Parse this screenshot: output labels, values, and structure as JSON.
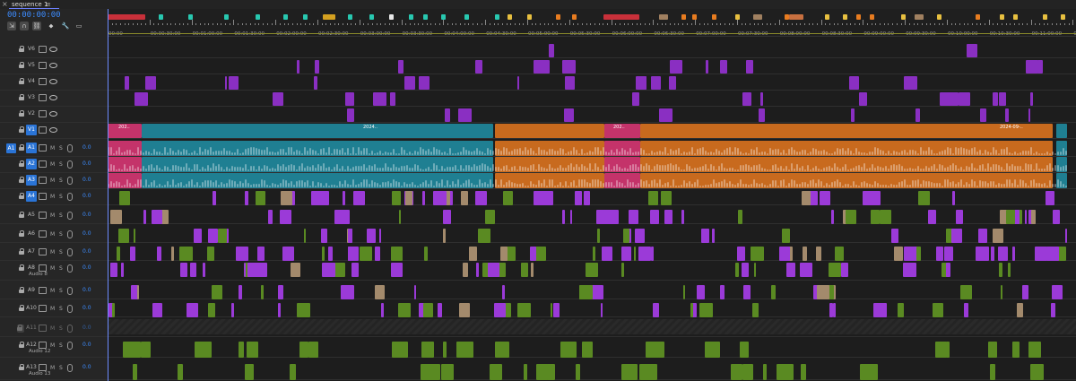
{
  "tab": {
    "name": "sequence 1",
    "close_glyph": "×",
    "menu_glyph": "≡"
  },
  "timecode": "00:00:00:00",
  "tools": [
    {
      "name": "insert-overwrite-icon",
      "glyph": "⇲"
    },
    {
      "name": "snap-icon",
      "glyph": "∩"
    },
    {
      "name": "linked-selection-icon",
      "glyph": "⛓"
    },
    {
      "name": "add-marker-icon",
      "glyph": "⬥"
    },
    {
      "name": "wrench-icon",
      "glyph": "🔧"
    },
    {
      "name": "captions-icon",
      "glyph": "▭"
    }
  ],
  "ruler": {
    "labels": [
      "00:00",
      "00:00:30:00",
      "00:01:00:00",
      "00:01:30:00",
      "00:02:00:00",
      "00:02:30:00",
      "00:03:00:00",
      "00:03:30:00",
      "00:04:00:00",
      "00:04:30:00",
      "00:05:00:00",
      "00:05:30:00",
      "00:06:00:00",
      "00:06:30:00",
      "00:07:00:00",
      "00:07:30:00",
      "00:08:00:00",
      "00:08:30:00",
      "00:09:00:00",
      "00:09:30:00",
      "00:10:00:00",
      "00:10:30:00",
      "00:11:00:00",
      "00:1"
    ]
  },
  "colors": {
    "accent": "#2a74d6",
    "timecode": "#3d8cff",
    "clip_pink": "#c4336a",
    "clip_teal": "#1f7f92",
    "clip_orange": "#c86a1e",
    "clip_purple": "#8a2fc2",
    "clip_violet": "#9b3ad8",
    "clip_green": "#5a8a22",
    "clip_tan": "#a38a6c"
  },
  "video_tracks": [
    {
      "name": "V6"
    },
    {
      "name": "V5"
    },
    {
      "name": "V4"
    },
    {
      "name": "V3"
    },
    {
      "name": "V2"
    },
    {
      "name": "V1",
      "active": true
    }
  ],
  "audio_tracks": [
    {
      "name": "A1",
      "src": "A1",
      "active": true,
      "m": "M",
      "s": "S",
      "vol": "0.0"
    },
    {
      "name": "A2",
      "active": true,
      "m": "M",
      "s": "S",
      "vol": "0.0"
    },
    {
      "name": "A3",
      "active": true,
      "m": "M",
      "s": "S",
      "vol": "0.0"
    },
    {
      "name": "A4",
      "active": true,
      "m": "M",
      "s": "S",
      "vol": "0.0"
    },
    {
      "name": "A5",
      "m": "M",
      "s": "S",
      "vol": "0.0"
    },
    {
      "name": "A6",
      "m": "M",
      "s": "S",
      "vol": "0.0"
    },
    {
      "name": "A7",
      "m": "M",
      "s": "S",
      "vol": "0.0"
    },
    {
      "name": "A8",
      "m": "M",
      "s": "S",
      "vol": "0.0",
      "label": "Audio 8"
    },
    {
      "name": "A9",
      "m": "M",
      "s": "S",
      "vol": "0.0"
    },
    {
      "name": "A10",
      "m": "M",
      "s": "S",
      "vol": "0.0"
    },
    {
      "name": "A11",
      "m": "M",
      "s": "S",
      "vol": "0.0",
      "locked": true
    },
    {
      "name": "A12",
      "m": "M",
      "s": "S",
      "vol": "0.0",
      "label": "Audio 12"
    },
    {
      "name": "A13",
      "m": "M",
      "s": "S",
      "vol": "0.0",
      "label": "Audio 13"
    }
  ],
  "clip_labels": {
    "v1_a": "202..",
    "v1_b": "2024..",
    "v1_c": "202..",
    "v1_d": "2024-09-..",
    "fx": "fx"
  }
}
